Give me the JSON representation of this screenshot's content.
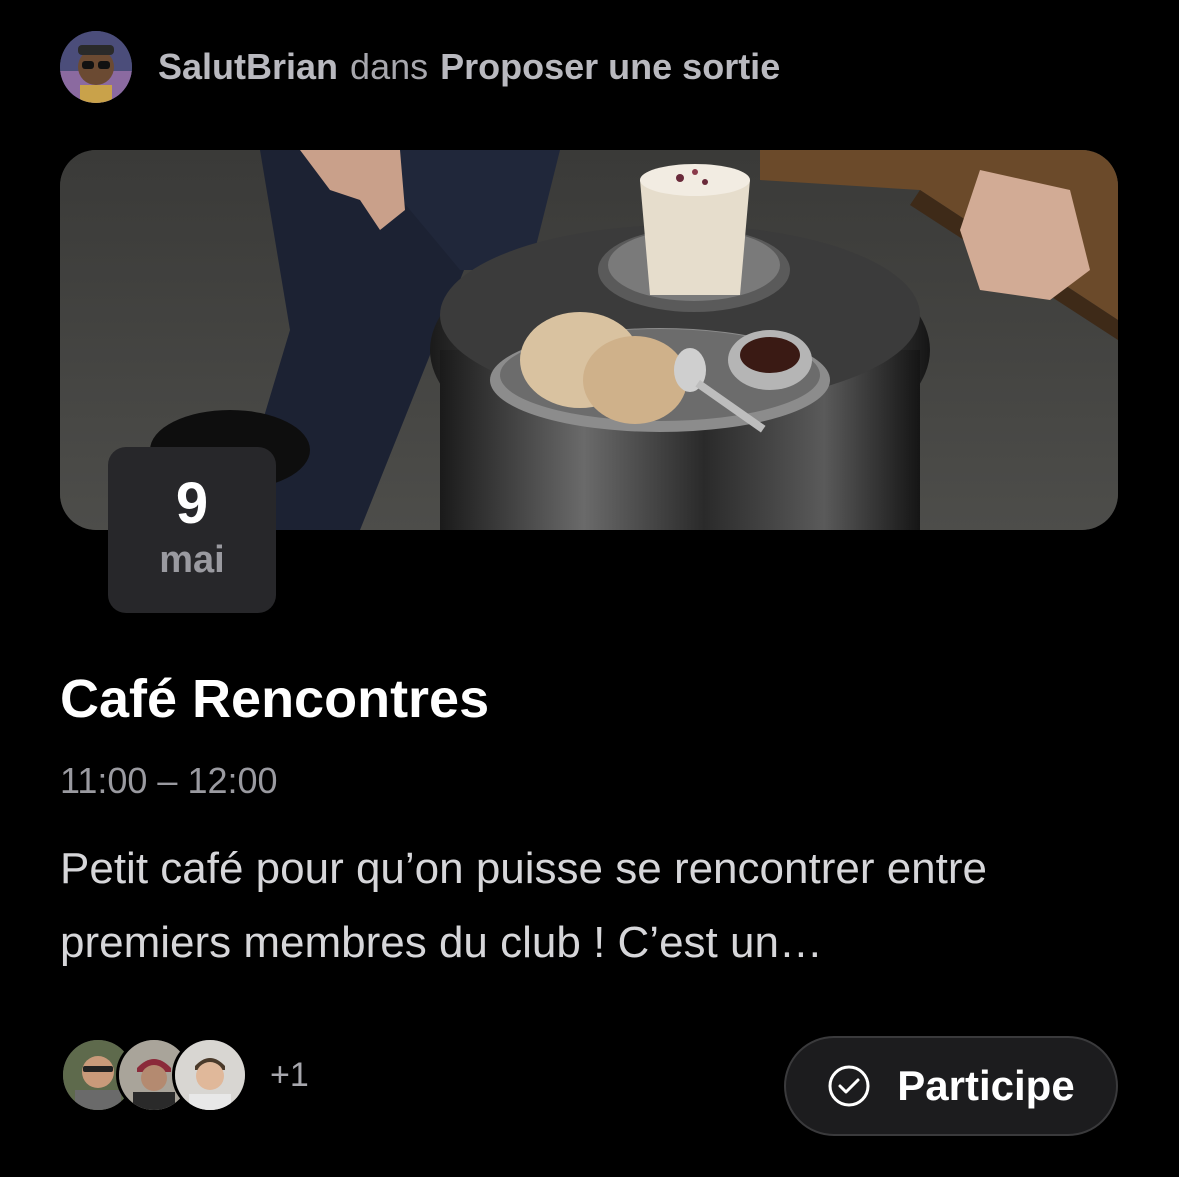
{
  "post": {
    "author": "SalutBrian",
    "connector": "dans",
    "channel": "Proposer une sortie"
  },
  "event": {
    "day": "9",
    "month": "mai",
    "title": "Café Rencontres",
    "time": "11:00 – 12:00",
    "description": "Petit café pour qu’on puisse se rencontrer entre premiers membres du club !  C’est un…"
  },
  "attendees": {
    "more_count": "+1"
  },
  "action": {
    "participate_label": "Participe",
    "icon": "check-circle-icon"
  }
}
